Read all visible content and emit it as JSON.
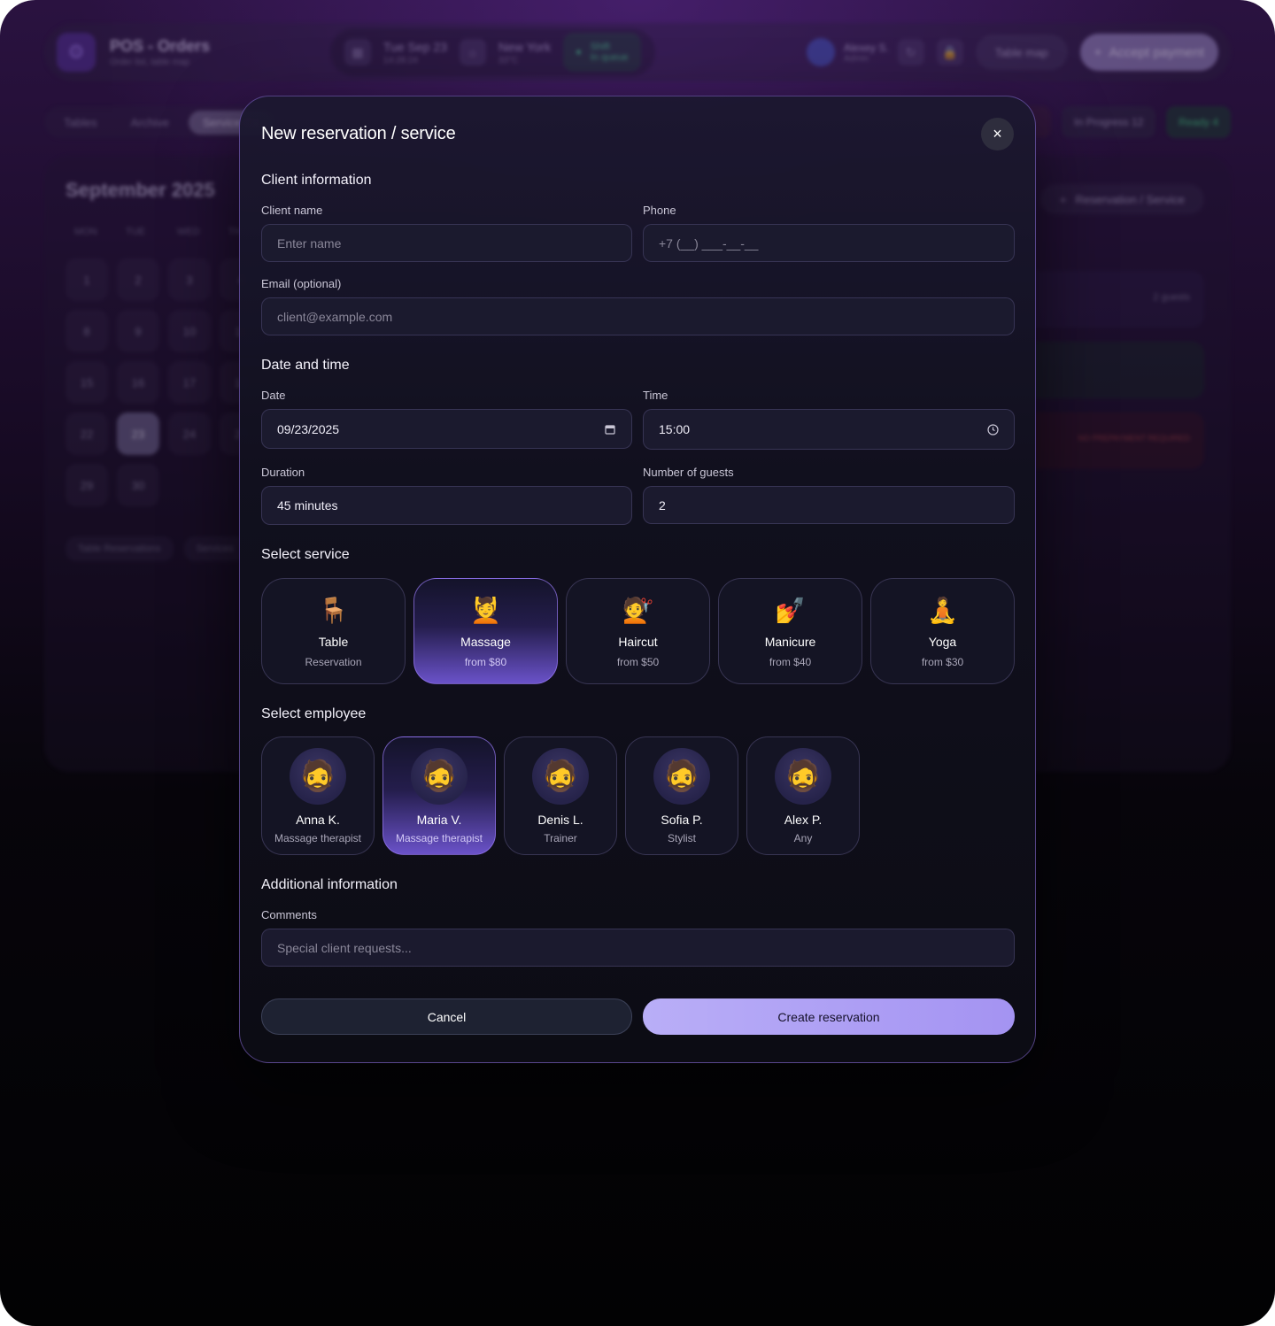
{
  "background": {
    "app_title": "POS - Orders",
    "app_subtitle": "Order list, table map",
    "date": "Tue Sep 23",
    "time": "14:28:24",
    "city": "New York",
    "temperature": "33°C",
    "shift_label": "Shift",
    "shift_status": "In queue",
    "user_name": "Alexey S.",
    "user_role": "Admin",
    "table_map": "Table map",
    "accept_payment": "Accept payment",
    "tabs": [
      "Tables",
      "Archive",
      "Service Ca"
    ],
    "in_progress": "In Progress 12",
    "ready": "Ready 4",
    "calendar_title": "September 2025",
    "weekdays": [
      "MON",
      "TUE",
      "WED",
      "TH"
    ],
    "days": [
      "1",
      "2",
      "3",
      "4",
      "8",
      "9",
      "10",
      "11",
      "15",
      "16",
      "17",
      "18",
      "22",
      "23",
      "24",
      "25",
      "29",
      "30"
    ],
    "calendar_tabs": [
      "Table Reservations",
      "Services"
    ],
    "reservation_button": "Reservation / Service",
    "guests_note": "2 guests",
    "no_prepayment": "NO PREPAYMENT REQUIRED"
  },
  "modal": {
    "title": "New reservation / service",
    "close_icon": "×",
    "client_section": "Client information",
    "client_name_label": "Client name",
    "client_name_placeholder": "Enter name",
    "phone_label": "Phone",
    "phone_placeholder": "+7 (__) ___-__-__",
    "email_label": "Email (optional)",
    "email_placeholder": "client@example.com",
    "datetime_section": "Date and time",
    "date_label": "Date",
    "date_value": "09/23/2025",
    "time_label": "Time",
    "time_value": "15:00",
    "duration_label": "Duration",
    "duration_value": "45 minutes",
    "guests_label": "Number of guests",
    "guests_value": "2",
    "service_section": "Select service",
    "services": [
      {
        "icon": "🪑",
        "name": "Table",
        "sub": "Reservation",
        "selected": false
      },
      {
        "icon": "💆",
        "name": "Massage",
        "sub": "from $80",
        "selected": true
      },
      {
        "icon": "💇",
        "name": "Haircut",
        "sub": "from $50",
        "selected": false
      },
      {
        "icon": "💅",
        "name": "Manicure",
        "sub": "from $40",
        "selected": false
      },
      {
        "icon": "🧘",
        "name": "Yoga",
        "sub": "from $30",
        "selected": false
      }
    ],
    "employee_section": "Select employee",
    "employees": [
      {
        "avatar": "🧔",
        "name": "Anna K.",
        "role": "Massage therapist",
        "selected": false
      },
      {
        "avatar": "🧔",
        "name": "Maria V.",
        "role": "Massage therapist",
        "selected": true
      },
      {
        "avatar": "🧔",
        "name": "Denis L.",
        "role": "Trainer",
        "selected": false
      },
      {
        "avatar": "🧔",
        "name": "Sofia P.",
        "role": "Stylist",
        "selected": false
      },
      {
        "avatar": "🧔",
        "name": "Alex P.",
        "role": "Any",
        "selected": false
      }
    ],
    "additional_section": "Additional information",
    "comments_label": "Comments",
    "comments_placeholder": "Special client requests...",
    "cancel_label": "Cancel",
    "create_label": "Create reservation"
  },
  "colors": {
    "accent": "#a493f2",
    "selected_card_bottom": "#6a52c9",
    "modal_border": "#8c6edc"
  }
}
